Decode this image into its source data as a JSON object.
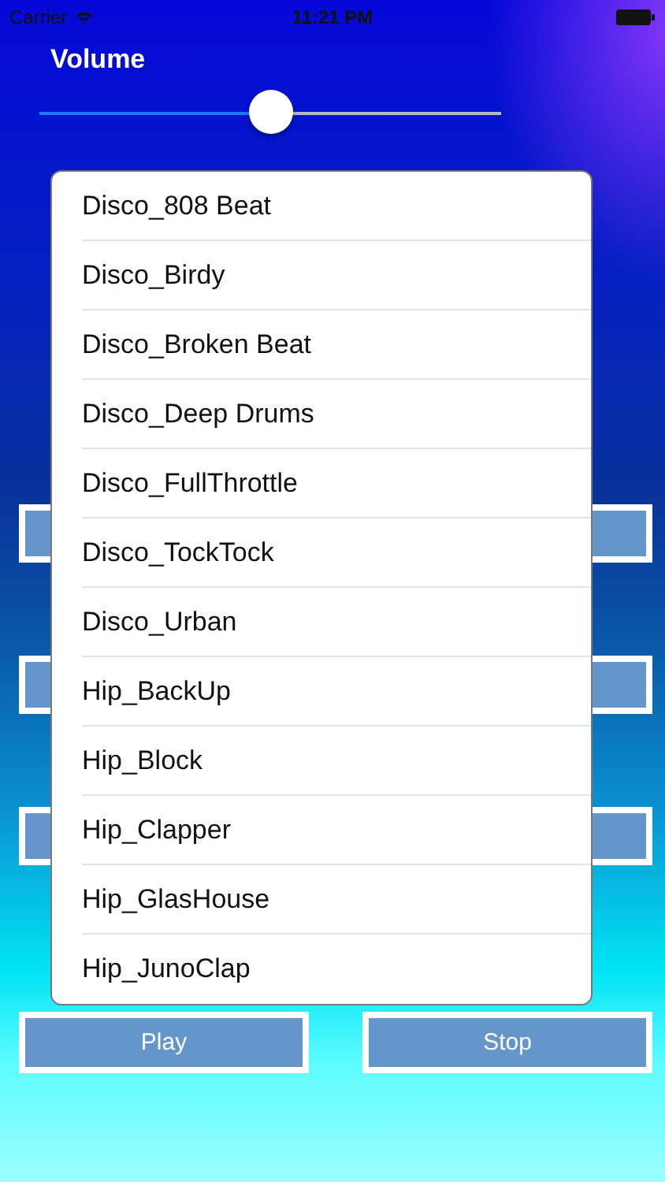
{
  "status_bar": {
    "carrier": "Carrier",
    "time": "11:21 PM"
  },
  "volume": {
    "label": "Volume",
    "level": 0.5
  },
  "sound_list": {
    "items": [
      {
        "label": "Disco_808 Beat"
      },
      {
        "label": "Disco_Birdy"
      },
      {
        "label": "Disco_Broken Beat"
      },
      {
        "label": "Disco_Deep Drums"
      },
      {
        "label": "Disco_FullThrottle"
      },
      {
        "label": "Disco_TockTock"
      },
      {
        "label": "Disco_Urban"
      },
      {
        "label": "Hip_BackUp"
      },
      {
        "label": "Hip_Block"
      },
      {
        "label": "Hip_Clapper"
      },
      {
        "label": "Hip_GlasHouse"
      },
      {
        "label": "Hip_JunoClap"
      }
    ]
  },
  "buttons": [
    {
      "label": "Play"
    },
    {
      "label": "Stop"
    }
  ]
}
